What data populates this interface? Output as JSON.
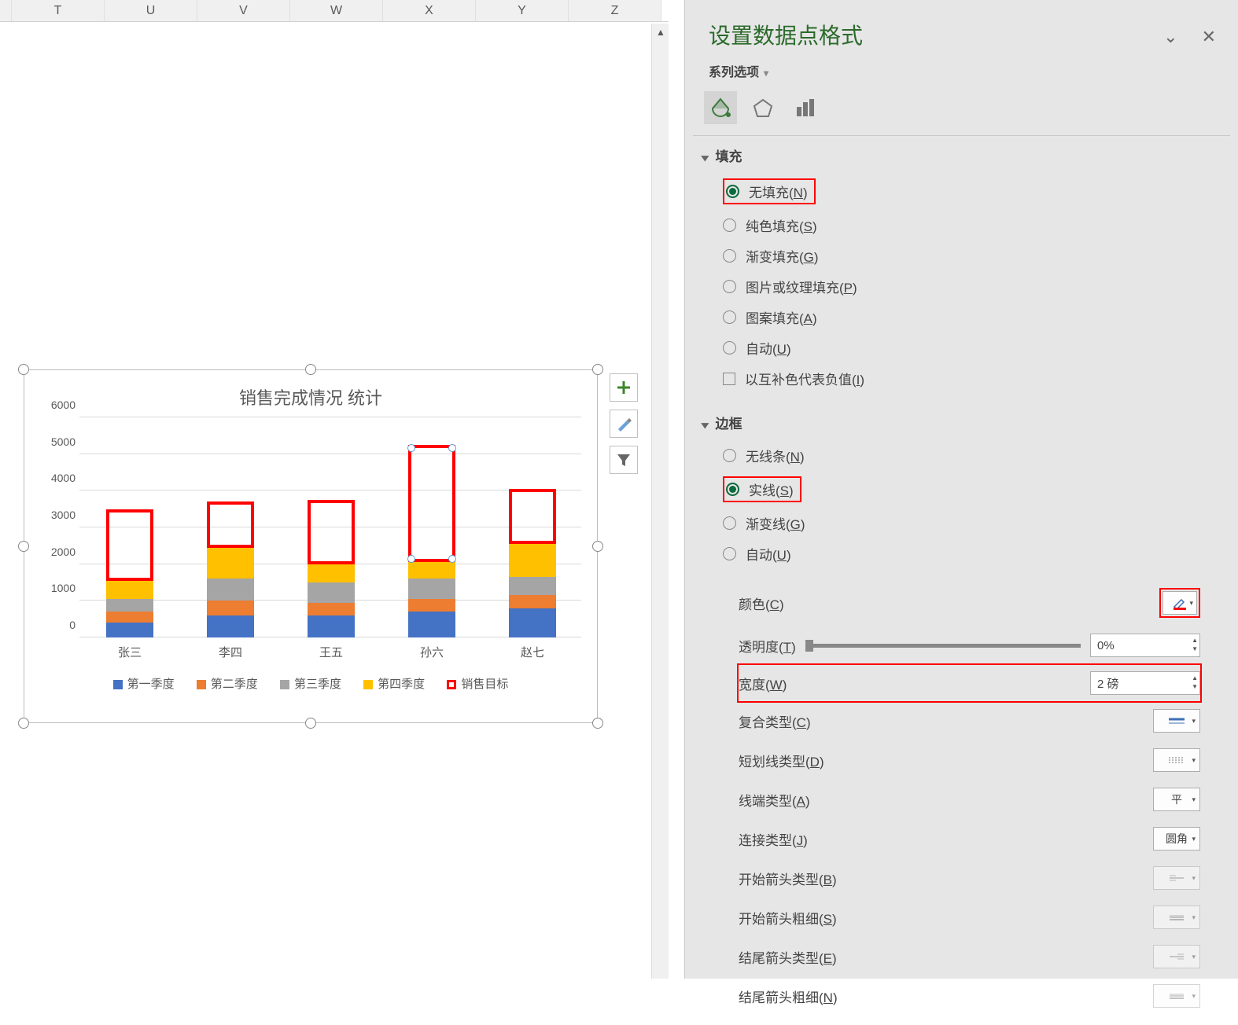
{
  "columns": [
    "T",
    "U",
    "V",
    "W",
    "X",
    "Y",
    "Z"
  ],
  "panel": {
    "title": "设置数据点格式",
    "series_options": "系列选项",
    "fill_section": "填充",
    "fill_options": {
      "none": "无填充(N)",
      "solid": "纯色填充(S)",
      "gradient": "渐变填充(G)",
      "picture": "图片或纹理填充(P)",
      "pattern": "图案填充(A)",
      "auto": "自动(U)",
      "invert": "以互补色代表负值(I)"
    },
    "border_section": "边框",
    "border_options": {
      "none": "无线条(N)",
      "solid": "实线(S)",
      "gradient": "渐变线(G)",
      "auto": "自动(U)"
    },
    "props": {
      "color": "颜色(C)",
      "transparency": "透明度(T)",
      "transparency_val": "0%",
      "width": "宽度(W)",
      "width_val": "2 磅",
      "compound": "复合类型(C)",
      "dash": "短划线类型(D)",
      "cap": "线端类型(A)",
      "cap_val": "平",
      "join": "连接类型(J)",
      "join_val": "圆角",
      "arrow_begin_type": "开始箭头类型(B)",
      "arrow_begin_size": "开始箭头粗细(S)",
      "arrow_end_type": "结尾箭头类型(E)",
      "arrow_end_size": "结尾箭头粗细(N)"
    }
  },
  "chart_data": {
    "type": "bar",
    "title": "销售完成情况 统计",
    "categories": [
      "张三",
      "李四",
      "王五",
      "孙六",
      "赵七"
    ],
    "series": [
      {
        "name": "第一季度",
        "values": [
          400,
          600,
          600,
          700,
          800
        ],
        "color": "#4472c4"
      },
      {
        "name": "第二季度",
        "values": [
          300,
          400,
          350,
          350,
          350
        ],
        "color": "#ed7d31"
      },
      {
        "name": "第三季度",
        "values": [
          350,
          600,
          550,
          550,
          500
        ],
        "color": "#a5a5a5"
      },
      {
        "name": "第四季度",
        "values": [
          500,
          850,
          500,
          450,
          900
        ],
        "color": "#ffc000"
      },
      {
        "name": "销售目标",
        "values": [
          3500,
          3700,
          3750,
          5250,
          4050
        ],
        "color": "#ff0000",
        "render": "outline"
      }
    ],
    "selected_point": {
      "series": "销售目标",
      "category": "孙六"
    },
    "ylabel": "",
    "xlabel": "",
    "ylim": [
      0,
      6000
    ],
    "yticks": [
      0,
      1000,
      2000,
      3000,
      4000,
      5000,
      6000
    ]
  }
}
